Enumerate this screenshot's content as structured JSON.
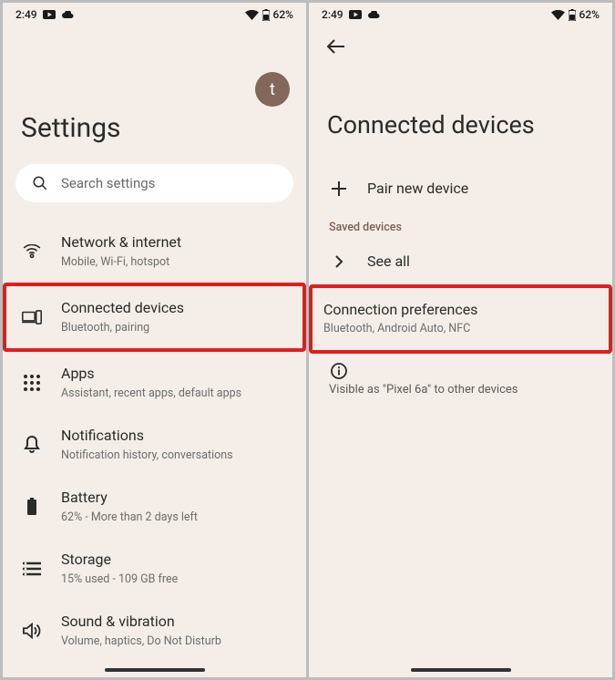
{
  "status": {
    "time": "2:49",
    "battery": "62%"
  },
  "left": {
    "avatar_letter": "t",
    "title": "Settings",
    "search_placeholder": "Search settings",
    "items": [
      {
        "title": "Network & internet",
        "sub": "Mobile, Wi-Fi, hotspot"
      },
      {
        "title": "Connected devices",
        "sub": "Bluetooth, pairing"
      },
      {
        "title": "Apps",
        "sub": "Assistant, recent apps, default apps"
      },
      {
        "title": "Notifications",
        "sub": "Notification history, conversations"
      },
      {
        "title": "Battery",
        "sub": "62% - More than 2 days left"
      },
      {
        "title": "Storage",
        "sub": "15% used - 109 GB free"
      },
      {
        "title": "Sound & vibration",
        "sub": "Volume, haptics, Do Not Disturb"
      }
    ]
  },
  "right": {
    "title": "Connected devices",
    "pair_label": "Pair new device",
    "saved_label": "Saved devices",
    "see_all_label": "See all",
    "pref_title": "Connection preferences",
    "pref_sub": "Bluetooth, Android Auto, NFC",
    "info_text": "Visible as \"Pixel 6a\" to other devices"
  }
}
